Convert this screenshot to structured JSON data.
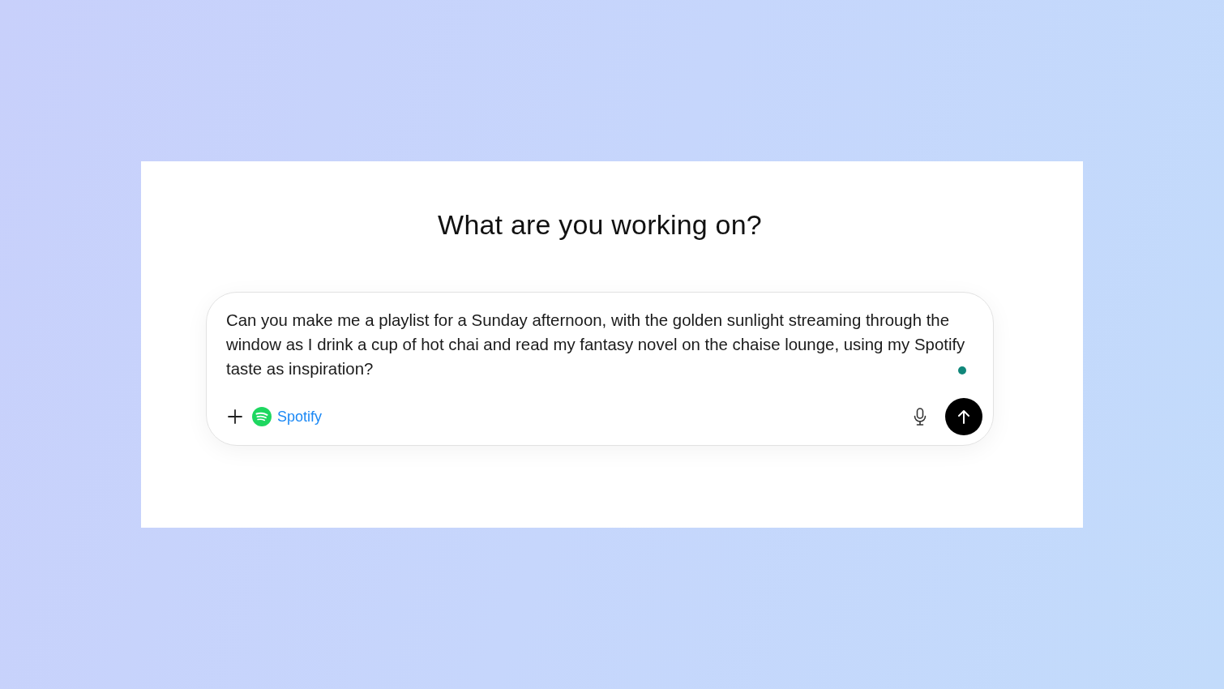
{
  "heading": "What are you working on?",
  "composer": {
    "value": "Can you make me a playlist for a Sunday afternoon, with the golden sunlight streaming through the window as I drink a cup of hot chai and read my fantasy novel on the chaise lounge, using my Spotify taste as inspiration?",
    "connector": {
      "label": "Spotify"
    }
  }
}
